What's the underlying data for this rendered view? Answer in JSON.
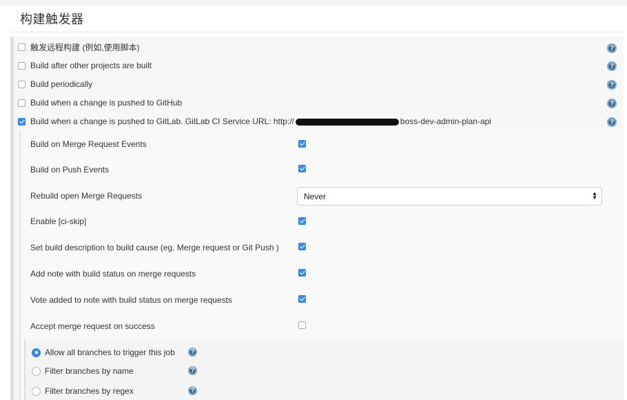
{
  "section": {
    "title": "构建触发器"
  },
  "triggers": [
    {
      "label": "触发远程构建 (例如,使用脚本)",
      "checked": false
    },
    {
      "label": "Build after other projects are built",
      "checked": false
    },
    {
      "label": "Build periodically",
      "checked": false
    },
    {
      "label": "Build when a change is pushed to GitHub",
      "checked": false
    },
    {
      "label_prefix": "Build when a change is pushed to GitLab. GitLab CI Service URL: http://",
      "label_suffix": "boss-dev-admin-plan-api",
      "checked": true
    }
  ],
  "gitlab_options": [
    {
      "label": "Build on Merge Request Events",
      "checked": true
    },
    {
      "label": "Build on Push Events",
      "checked": true
    },
    {
      "label": "Rebuild open Merge Requests",
      "select_value": "Never"
    },
    {
      "label": "Enable [ci-skip]",
      "checked": true
    },
    {
      "label": "Set build description to build cause (eg. Merge request or Git Push )",
      "checked": true
    },
    {
      "label": "Add note with build status on merge requests",
      "checked": true
    },
    {
      "label": "Vote added to note with build status on merge requests",
      "checked": true
    },
    {
      "label": "Accept merge request on success",
      "checked": false
    }
  ],
  "branch_filter": [
    {
      "label": "Allow all branches to trigger this job",
      "selected": true
    },
    {
      "label": "Filter branches by name",
      "selected": false
    },
    {
      "label": "Filter branches by regex",
      "selected": false
    }
  ],
  "help_glyph": "?",
  "icons": {
    "help": "help-icon",
    "checkbox": "checkbox",
    "radio": "radio-button",
    "select_arrows": "sort-arrows-icon"
  },
  "colors": {
    "accent": "#3b8eea",
    "help": "#3d6a93",
    "panel": "#f7f7f7"
  }
}
